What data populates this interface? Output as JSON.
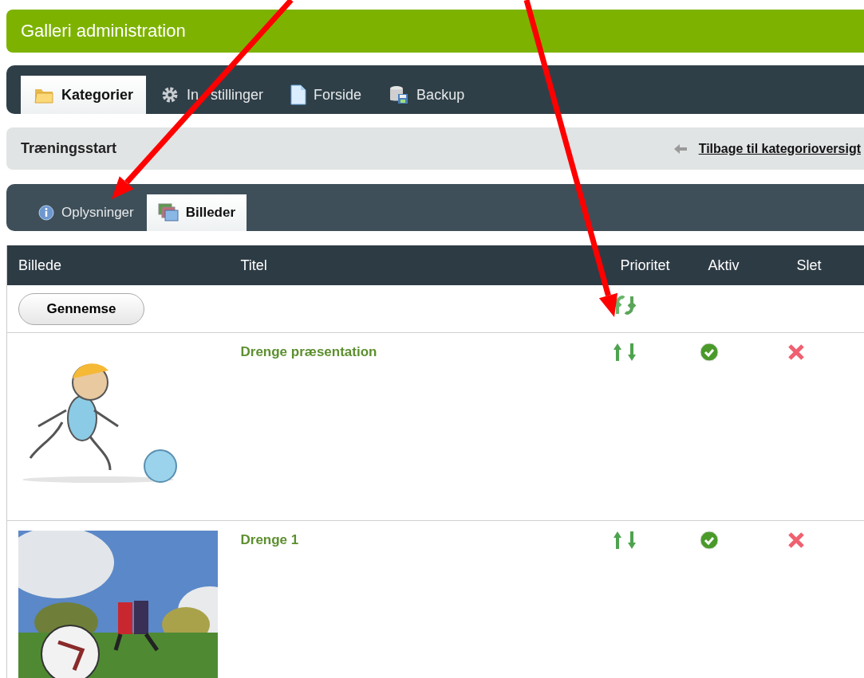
{
  "header": {
    "title": "Galleri administration"
  },
  "main_tabs": [
    {
      "label": "Kategorier",
      "selected": true
    },
    {
      "label_parts": [
        "In",
        "stillinger"
      ],
      "selected": false
    },
    {
      "label": "Forside",
      "selected": false
    },
    {
      "label": "Backup",
      "selected": false
    }
  ],
  "category_bar": {
    "title": "Træningsstart",
    "back_link": "Tilbage til kategorioversigt"
  },
  "sub_tabs": [
    {
      "label": "Oplysninger",
      "selected": false
    },
    {
      "label": "Billeder",
      "selected": true
    }
  ],
  "table": {
    "columns": [
      "Billede",
      "Titel",
      "Prioritet",
      "Aktiv",
      "Slet"
    ],
    "browse_button": "Gennemse",
    "rows": [
      {
        "title": "Drenge præsentation",
        "active": true
      },
      {
        "title": "Drenge 1",
        "active": true
      }
    ]
  },
  "annotations": [
    {
      "kind": "arrow",
      "color": "#ff0000"
    },
    {
      "kind": "arrow",
      "color": "#ff0000"
    }
  ]
}
